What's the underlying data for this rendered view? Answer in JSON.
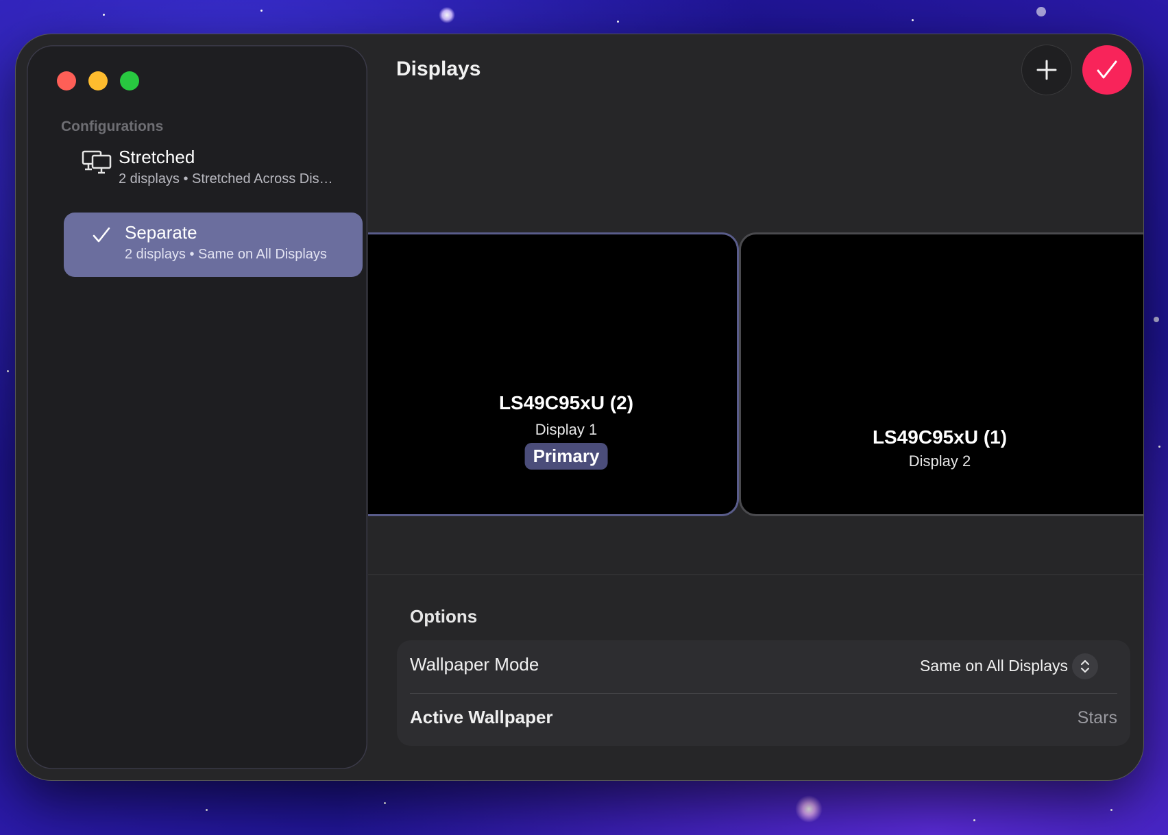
{
  "window": {
    "title": "Displays"
  },
  "sidebar": {
    "section_title": "Configurations",
    "configs": [
      {
        "title": "Stretched",
        "subtitle": "2 displays • Stretched Across Dis…",
        "icon": "monitors-icon",
        "selected": false
      },
      {
        "title": "Separate",
        "subtitle": "2 displays • Same on All Displays",
        "icon": "checkmark-icon",
        "selected": true
      }
    ]
  },
  "toolbar": {
    "add_icon": "plus-icon",
    "apply_icon": "checkmark-icon",
    "apply_color": "#f8245a"
  },
  "displays": [
    {
      "name": "LS49C95xU (2)",
      "label": "Display 1",
      "badge": "Primary"
    },
    {
      "name": "LS49C95xU (1)",
      "label": "Display 2"
    }
  ],
  "options": {
    "section_title": "Options",
    "rows": [
      {
        "label": "Wallpaper Mode",
        "value": "Same on All Displays"
      },
      {
        "label": "Active Wallpaper",
        "value": "Stars"
      }
    ]
  },
  "colors": {
    "selected_row": "#6b6e9e",
    "primary_badge": "#4b4d7a"
  }
}
